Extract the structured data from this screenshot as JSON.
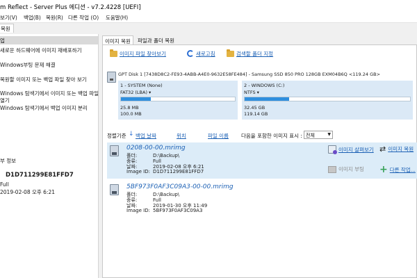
{
  "window": {
    "title": "m Reflect - Server Plus 에디션 - v7.2.4228  [UEFI]"
  },
  "menu": [
    {
      "label": "보기(V)"
    },
    {
      "label": "백업(B)"
    },
    {
      "label": "복원(R)"
    },
    {
      "label": "다른 작업 (O)"
    },
    {
      "label": "도움말(H)"
    }
  ],
  "app_tab": {
    "label": "복원"
  },
  "sidebar": {
    "header": "업",
    "items": [
      {
        "label": "새로운 하드웨어에 이미지 재배포하기"
      },
      {
        "label": "Windows부팅 문제 해결"
      },
      {
        "label": "복원할 이미지 또는 백업 파일 찾아 보기"
      },
      {
        "label": "Windows 탐색기에서 이미지 또는 백업 파일"
      },
      {
        "label": "열기"
      },
      {
        "label": "Windows 탐색기에서 백업 이미지 분리"
      }
    ],
    "info_title": "부 정보",
    "info_id": "D1D711299E81FFD7",
    "info_lines": [
      "Full",
      "2019-02-08 오후 6:21"
    ]
  },
  "main_tabs": [
    {
      "label": "이미지 복원",
      "active": true
    },
    {
      "label": "파일과 폴더 복원",
      "active": false
    }
  ],
  "toolbar": {
    "browse": "이미지 파일 찾아보기",
    "refresh": "새로고침",
    "folder": "검색할 폴더 지정"
  },
  "disk": {
    "label": "GPT Disk 1 [7438D8C2-FE93-4ABB-A4E0-9632E58FE484] - Samsung SSD 850 PRO 128GB EXM04B6Q  <119.24 GB>",
    "partitions": [
      {
        "name": "1 - SYSTEM (None)",
        "fs": "FAT32 (LBA) ▾",
        "used": "25.8 MB",
        "total": "100.0 MB",
        "fill_fraction": 0.26
      },
      {
        "name": "2 - WINDOWS (C:)",
        "fs": "NTFS ▾",
        "used": "32.45 GB",
        "total": "119.14 GB",
        "fill_fraction": 0.27
      }
    ]
  },
  "sort": {
    "label": "정렬기준",
    "by_date": "백업 날짜",
    "by_location": "위치",
    "by_filename": "파일 이름",
    "filter_label": "다음을 포함한 이미지 표시 :",
    "filter_value": "전체"
  },
  "labels": {
    "folder": "폴더:",
    "type": "종류:",
    "date": "날짜:",
    "image_id": "Image ID:"
  },
  "images": [
    {
      "name": "0208-00-00.mrimg",
      "folder": "D:\\Backup\\",
      "type": "Full",
      "date": "2019-02-08 오후 6:21",
      "image_id": "D1D711299E81FFD7",
      "selected": true
    },
    {
      "name": "5BF973F0AF3C09A3-00-00.mrimg",
      "folder": "D:\\Backup\\",
      "type": "Full",
      "date": "2019-01-30 오후 11:49",
      "image_id": "5BF973F0AF3C09A3",
      "selected": false
    }
  ],
  "actions": {
    "browse_image": "이미지 살펴보기",
    "restore_image": "이미지 복원",
    "boot_image": "이미지 부팅",
    "other_tasks": "다른 작업..."
  }
}
